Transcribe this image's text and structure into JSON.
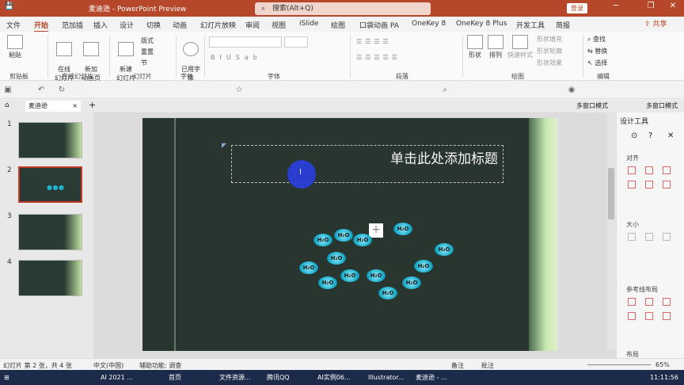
{
  "window": {
    "title": "麦迪逊  -  PowerPoint Preview",
    "login": "登录"
  },
  "search": {
    "placeholder": "搜索(Alt+Q)"
  },
  "tabs": [
    "文件",
    "开始",
    "范加插",
    "插入",
    "设计",
    "切换",
    "动画",
    "幻灯片放映",
    "审阅",
    "视图",
    "iSlide",
    "绘图",
    "口袋动画 PA",
    "OneKey 8",
    "OneKey 8 Plus",
    "开发工具",
    "简报"
  ],
  "active_tab": "开始",
  "share": "共享",
  "ribbon": {
    "paste": "粘贴",
    "online_slide": "在线\n幻灯片",
    "new_anim_page": "新加\n动画页",
    "new_slide": "新建\n幻灯片",
    "layout": "版式",
    "reset": "重置",
    "section": "节",
    "font_btn": "已用字\n体",
    "shape": "形状",
    "arrange": "排列",
    "quick_style": "快速样式",
    "fill": "形状填充",
    "outline": "形状轮廓",
    "effect": "形状效果",
    "find": "查找",
    "replace": "替换",
    "select": "选择",
    "groups": [
      "剪贴板",
      "在线幻灯片",
      "幻灯片",
      "字体",
      "字体",
      "段落",
      "绘图",
      "编辑"
    ]
  },
  "doc_tab": "麦迪逊",
  "toolbar_right": [
    "多窗口模式",
    "多窗口模式"
  ],
  "thumbnails": [
    {
      "num": "1"
    },
    {
      "num": "2"
    },
    {
      "num": "3"
    },
    {
      "num": "4"
    }
  ],
  "slide": {
    "title": "单击此处添加标题",
    "molecule_label": "H₂O"
  },
  "pane": {
    "title": "设计工具",
    "sections": [
      "对齐",
      "大小",
      "参考线布局",
      "布局"
    ]
  },
  "status": {
    "slide_info": "幻灯片 第 2 张，共 4 张",
    "lang": "中文(中国)",
    "accessibility": "辅助功能: 调查",
    "notes": "备注",
    "comments": "批注",
    "zoom": "65%"
  },
  "taskbar": [
    "AI 2021 ...",
    "首页",
    "文件资源...",
    "腾讯QQ",
    "AI实例06...",
    "Illustrator...",
    "麦迪逊 - ..."
  ],
  "clock": "11:11:56"
}
